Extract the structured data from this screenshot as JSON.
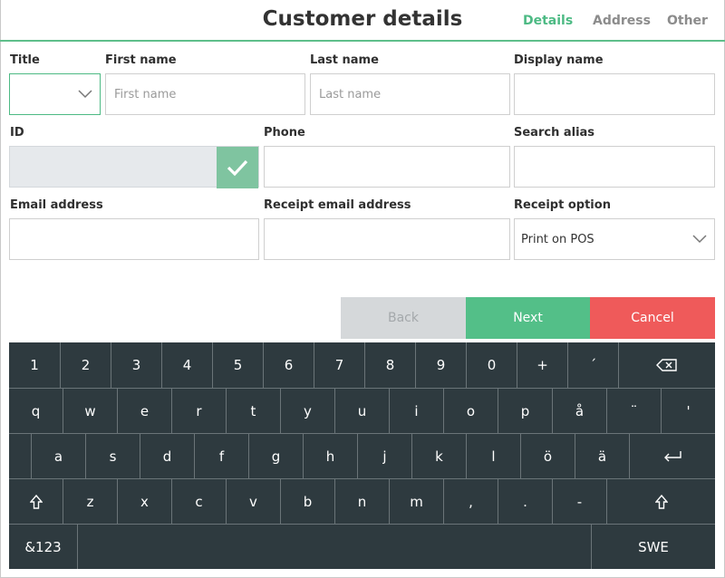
{
  "header": {
    "title": "Customer details",
    "tabs": [
      {
        "label": "Details",
        "active": true
      },
      {
        "label": "Address",
        "active": false
      },
      {
        "label": "Other",
        "active": false
      }
    ]
  },
  "form": {
    "title_label": "Title",
    "title_value": "",
    "first_name_label": "First name",
    "first_name_placeholder": "First name",
    "last_name_label": "Last name",
    "last_name_placeholder": "Last name",
    "display_name_label": "Display name",
    "id_label": "ID",
    "phone_label": "Phone",
    "search_alias_label": "Search alias",
    "email_label": "Email address",
    "receipt_email_label": "Receipt email address",
    "receipt_option_label": "Receipt option",
    "receipt_option_value": "Print on POS"
  },
  "actions": {
    "back": "Back",
    "next": "Next",
    "cancel": "Cancel"
  },
  "keyboard": {
    "row1": [
      "1",
      "2",
      "3",
      "4",
      "5",
      "6",
      "7",
      "8",
      "9",
      "0",
      "+",
      "´"
    ],
    "row2": [
      "q",
      "w",
      "e",
      "r",
      "t",
      "y",
      "u",
      "i",
      "o",
      "p",
      "å",
      "¨",
      "'"
    ],
    "row3": [
      "a",
      "s",
      "d",
      "f",
      "g",
      "h",
      "j",
      "k",
      "l",
      "ö",
      "ä"
    ],
    "row4": [
      "z",
      "x",
      "c",
      "v",
      "b",
      "n",
      "m",
      ",",
      ".",
      "-"
    ],
    "mode_key": "&123",
    "language_key": "SWE"
  },
  "colors": {
    "accent": "#4dba84",
    "next": "#53bf88",
    "cancel": "#ef5a5a",
    "back": "#d5d8da",
    "keyboard": "#2e3a3f"
  }
}
